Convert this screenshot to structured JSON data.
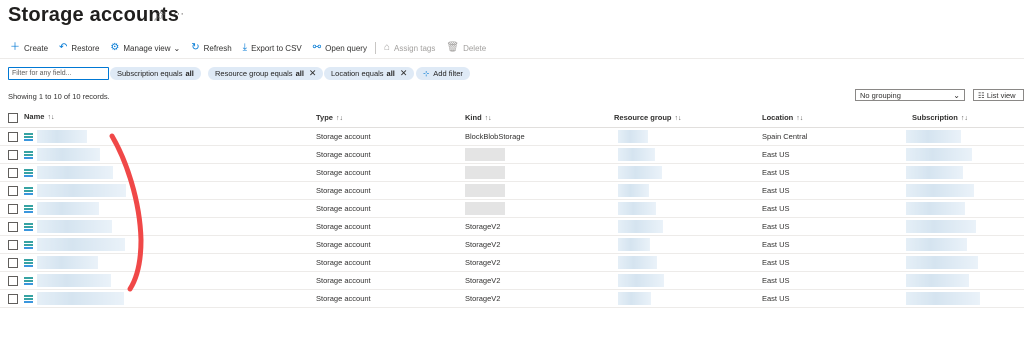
{
  "page": {
    "title": "Storage accounts"
  },
  "toolbar": {
    "create": "Create",
    "restore": "Restore",
    "manage_view": "Manage view",
    "refresh": "Refresh",
    "export": "Export to CSV",
    "open_query": "Open query",
    "assign_tags": "Assign tags",
    "delete": "Delete"
  },
  "filters": {
    "placeholder": "Filter for any field...",
    "pills": [
      {
        "label": "Subscription equals",
        "value": "all"
      },
      {
        "label": "Resource group equals",
        "value": "all"
      },
      {
        "label": "Location equals",
        "value": "all"
      }
    ],
    "add_filter": "Add filter"
  },
  "records_text": "Showing 1 to 10 of 10 records.",
  "grouping": {
    "selected": "No grouping",
    "list_view": "List view"
  },
  "table": {
    "columns": [
      "Name",
      "Type",
      "Kind",
      "Resource group",
      "Location",
      "Subscription"
    ],
    "sort_indicators": {
      "name": "↑↓",
      "other": "↑↓"
    },
    "rows": [
      {
        "type": "Storage account",
        "kind": "BlockBlobStorage",
        "location": "Spain Central"
      },
      {
        "type": "Storage account",
        "kind": "",
        "location": "East US"
      },
      {
        "type": "Storage account",
        "kind": "",
        "location": "East US"
      },
      {
        "type": "Storage account",
        "kind": "",
        "location": "East US"
      },
      {
        "type": "Storage account",
        "kind": "",
        "location": "East US"
      },
      {
        "type": "Storage account",
        "kind": "StorageV2",
        "location": "East US"
      },
      {
        "type": "Storage account",
        "kind": "StorageV2",
        "location": "East US"
      },
      {
        "type": "Storage account",
        "kind": "StorageV2",
        "location": "East US"
      },
      {
        "type": "Storage account",
        "kind": "StorageV2",
        "location": "East US"
      },
      {
        "type": "Storage account",
        "kind": "StorageV2",
        "location": "East US"
      }
    ]
  },
  "colors": {
    "accent": "#0078d4",
    "pill_bg": "#dfeaf6",
    "annotation_red": "#f04848"
  }
}
